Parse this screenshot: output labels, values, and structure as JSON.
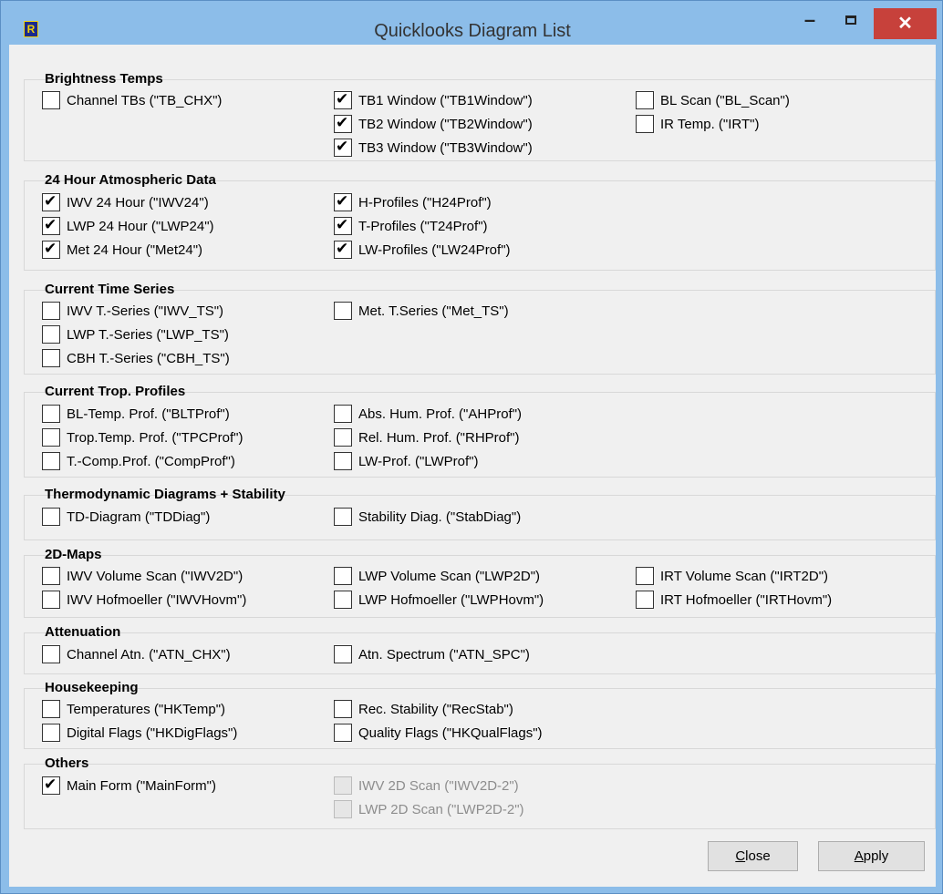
{
  "window": {
    "title": "Quicklooks Diagram List",
    "icon": "app-logo-icon",
    "icon_glyph": "R",
    "minimize_glyph": "–",
    "close_glyph": "✕",
    "close_color": "#c7413b",
    "titlebar_color": "#8cbde9"
  },
  "groups": [
    {
      "title": "Brightness Temps",
      "items": [
        {
          "label": "Channel TBs (\"TB_CHX\")",
          "checked": false
        },
        {
          "label": "TB1 Window (\"TB1Window\")",
          "checked": true
        },
        {
          "label": "TB2 Window (\"TB2Window\")",
          "checked": true
        },
        {
          "label": "TB3 Window (\"TB3Window\")",
          "checked": true
        },
        {
          "label": "BL Scan (\"BL_Scan\")",
          "checked": false
        },
        {
          "label": "IR Temp. (\"IRT\")",
          "checked": false
        }
      ]
    },
    {
      "title": "24 Hour Atmospheric Data",
      "items": [
        {
          "label": "IWV 24 Hour (\"IWV24\")",
          "checked": true
        },
        {
          "label": "LWP 24 Hour (\"LWP24\")",
          "checked": true
        },
        {
          "label": "Met 24 Hour (\"Met24\")",
          "checked": true
        },
        {
          "label": "H-Profiles (\"H24Prof\")",
          "checked": true
        },
        {
          "label": "T-Profiles (\"T24Prof\")",
          "checked": true
        },
        {
          "label": "LW-Profiles (\"LW24Prof\")",
          "checked": true
        }
      ]
    },
    {
      "title": "Current Time Series",
      "items": [
        {
          "label": "IWV T.-Series (\"IWV_TS\")",
          "checked": false
        },
        {
          "label": "LWP T.-Series (\"LWP_TS\")",
          "checked": false
        },
        {
          "label": "CBH T.-Series (\"CBH_TS\")",
          "checked": false
        },
        {
          "label": "Met. T.Series (\"Met_TS\")",
          "checked": false
        }
      ]
    },
    {
      "title": "Current Trop. Profiles",
      "items": [
        {
          "label": "BL-Temp. Prof. (\"BLTProf\")",
          "checked": false
        },
        {
          "label": "Trop.Temp. Prof. (\"TPCProf\")",
          "checked": false
        },
        {
          "label": "T.-Comp.Prof. (\"CompProf\")",
          "checked": false
        },
        {
          "label": "Abs. Hum. Prof. (\"AHProf\")",
          "checked": false
        },
        {
          "label": "Rel. Hum. Prof. (\"RHProf\")",
          "checked": false
        },
        {
          "label": "LW-Prof. (\"LWProf\")",
          "checked": false
        }
      ]
    },
    {
      "title": "Thermodynamic Diagrams + Stability",
      "items": [
        {
          "label": "TD-Diagram (\"TDDiag\")",
          "checked": false
        },
        {
          "label": "Stability Diag. (\"StabDiag\")",
          "checked": false
        }
      ]
    },
    {
      "title": "2D-Maps",
      "items": [
        {
          "label": "IWV Volume Scan (\"IWV2D\")",
          "checked": false
        },
        {
          "label": "IWV Hofmoeller (\"IWVHovm\")",
          "checked": false
        },
        {
          "label": "LWP Volume Scan (\"LWP2D\")",
          "checked": false
        },
        {
          "label": "LWP Hofmoeller (\"LWPHovm\")",
          "checked": false
        },
        {
          "label": "IRT Volume Scan (\"IRT2D\")",
          "checked": false
        },
        {
          "label": "IRT Hofmoeller (\"IRTHovm\")",
          "checked": false
        }
      ]
    },
    {
      "title": "Attenuation",
      "items": [
        {
          "label": "Channel Atn. (\"ATN_CHX\")",
          "checked": false
        },
        {
          "label": "Atn. Spectrum (\"ATN_SPC\")",
          "checked": false
        }
      ]
    },
    {
      "title": "Housekeeping",
      "items": [
        {
          "label": "Temperatures (\"HKTemp\")",
          "checked": false
        },
        {
          "label": "Digital Flags (\"HKDigFlags\")",
          "checked": false
        },
        {
          "label": "Rec. Stability (\"RecStab\")",
          "checked": false
        },
        {
          "label": "Quality Flags (\"HKQualFlags\")",
          "checked": false
        }
      ]
    },
    {
      "title": "Others",
      "items": [
        {
          "label": "Main Form (\"MainForm\")",
          "checked": true,
          "enabled": true
        },
        {
          "label": "IWV 2D Scan (\"IWV2D-2\")",
          "checked": false,
          "enabled": false
        },
        {
          "label": "LWP 2D Scan (\"LWP2D-2\")",
          "checked": false,
          "enabled": false
        }
      ]
    }
  ],
  "buttons": {
    "close": {
      "label": "Close",
      "mnemonic": "C"
    },
    "apply": {
      "label": "Apply",
      "mnemonic": "A"
    }
  }
}
